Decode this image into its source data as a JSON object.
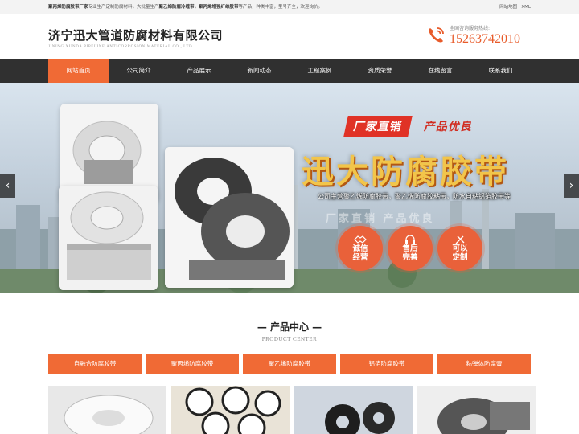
{
  "topbar": {
    "notice_brand": "聚丙烯防腐胶带厂家",
    "notice_mid": "专业生产定制防腐材料，大批量生产",
    "notice_product": "聚乙烯防腐冷缠带，聚丙烯增强纤维胶带",
    "notice_tail": "等产品，种类丰富，型号齐全，欢迎询价。",
    "links": "网站地图 | XML"
  },
  "header": {
    "company_cn": "济宁迅大管道防腐材料有限公司",
    "company_en": "JINING XUNDA PIPELINE ANTICORROSION MATERIAL CO., LTD",
    "hotline_label": "全国咨询服务热线:",
    "hotline_number": "15263742010"
  },
  "nav": {
    "items": [
      {
        "label": "网站首页",
        "active": true
      },
      {
        "label": "公司简介"
      },
      {
        "label": "产品展示"
      },
      {
        "label": "新闻动态"
      },
      {
        "label": "工程案例"
      },
      {
        "label": "资质荣誉"
      },
      {
        "label": "在线留言"
      },
      {
        "label": "联系我们"
      }
    ]
  },
  "banner": {
    "tag1": "厂家直销",
    "tag2": "产品优良",
    "title": "迅大防腐胶带",
    "subtitle": "公司主营聚乙烯防腐胶带，聚乙烯防腐胶粘带，防水自粘铝箔胶带等",
    "ghost": "厂家直销        产品优良",
    "badges": [
      {
        "line1": "诚信",
        "line2": "经营"
      },
      {
        "line1": "售后",
        "line2": "完善"
      },
      {
        "line1": "可以",
        "line2": "定制"
      }
    ],
    "arrow_left": "‹",
    "arrow_right": "›"
  },
  "products": {
    "title": "— 产品中心 —",
    "title_en": "PRODUCT CENTER",
    "categories": [
      "自融合防腐胶带",
      "聚丙烯防腐胶带",
      "聚乙烯防腐胶带",
      "铝箔防腐胶带",
      "粘弹体防腐膏"
    ]
  },
  "colors": {
    "accent": "#f06a35",
    "nav_bg": "#303030",
    "hotline": "#e85b2a"
  }
}
